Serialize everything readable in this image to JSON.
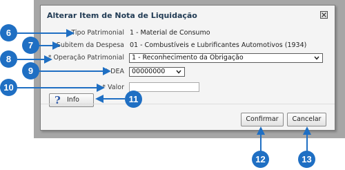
{
  "dialog": {
    "title": "Alterar Item de Nota de Liquidação",
    "close_icon": "close-x-icon"
  },
  "form": {
    "tipo_patrimonial": {
      "label": "Tipo Patrimonial",
      "value": "1 - Material de Consumo"
    },
    "subitem_despesa": {
      "label": "Subitem da Despesa",
      "value": "01 - Combustíveis e Lubrificantes Automotivos (1934)"
    },
    "operacao_patrimonial": {
      "label": "* Operação Patrimonial",
      "selected": "1 - Reconhecimento da Obrigação"
    },
    "dea": {
      "label": "* DEA",
      "selected": "00000000"
    },
    "valor": {
      "label": "* Valor",
      "value": ""
    }
  },
  "buttons": {
    "info": "Info",
    "confirmar": "Confirmar",
    "cancelar": "Cancelar"
  },
  "annotations": [
    "6",
    "7",
    "8",
    "9",
    "10",
    "11",
    "12",
    "13"
  ],
  "colors": {
    "badge": "#1f6fc3",
    "arrow": "#1f6fc3",
    "label_text": "#3c3c3c",
    "title_text": "#223c55",
    "backdrop": "#a6a6a6"
  }
}
